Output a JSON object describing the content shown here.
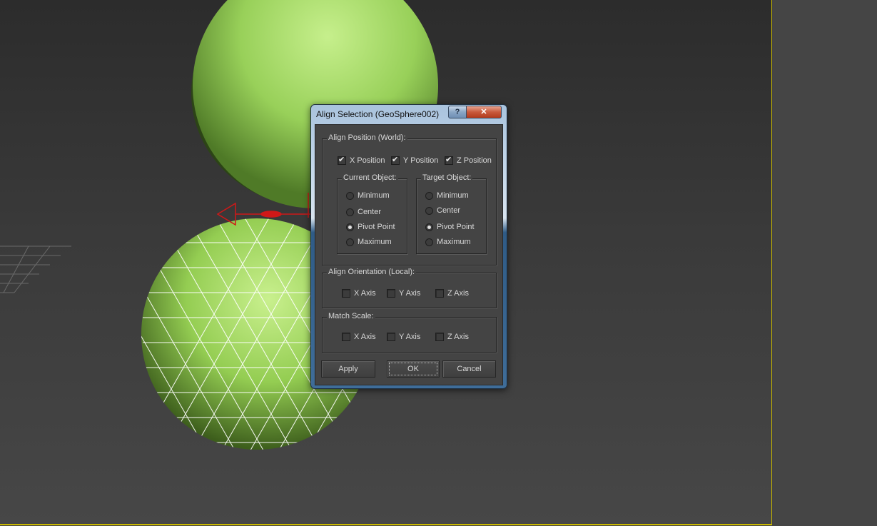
{
  "dialog": {
    "title": "Align Selection (GeoSphere002)",
    "help_label": "?",
    "close_label": "✕"
  },
  "align_position": {
    "legend": "Align Position (World):",
    "axes": [
      {
        "label": "X Position",
        "checked": true
      },
      {
        "label": "Y Position",
        "checked": true
      },
      {
        "label": "Z Position",
        "checked": true
      }
    ],
    "current_object": {
      "legend": "Current Object:",
      "options": [
        "Minimum",
        "Center",
        "Pivot Point",
        "Maximum"
      ],
      "selected": "Pivot Point"
    },
    "target_object": {
      "legend": "Target Object:",
      "options": [
        "Minimum",
        "Center",
        "Pivot Point",
        "Maximum"
      ],
      "selected": "Pivot Point"
    }
  },
  "align_orientation": {
    "legend": "Align Orientation (Local):",
    "axes": [
      {
        "label": "X Axis",
        "checked": false
      },
      {
        "label": "Y Axis",
        "checked": false
      },
      {
        "label": "Z Axis",
        "checked": false
      }
    ]
  },
  "match_scale": {
    "legend": "Match Scale:",
    "axes": [
      {
        "label": "X Axis",
        "checked": false
      },
      {
        "label": "Y Axis",
        "checked": false
      },
      {
        "label": "Z Axis",
        "checked": false
      }
    ]
  },
  "buttons": {
    "apply": "Apply",
    "ok": "OK",
    "cancel": "Cancel"
  },
  "colors": {
    "viewport_border": "#c9b800",
    "sphere_green": "#9ed65c",
    "selection_red": "#d01818"
  }
}
